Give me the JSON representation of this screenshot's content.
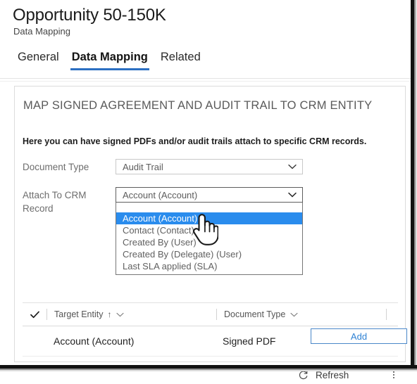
{
  "header": {
    "title": "Opportunity 50-150K",
    "subtitle": "Data Mapping",
    "tabs": [
      {
        "label": "General",
        "active": false
      },
      {
        "label": "Data Mapping",
        "active": true
      },
      {
        "label": "Related",
        "active": false
      }
    ]
  },
  "panel": {
    "section_heading": "MAP SIGNED AGREEMENT AND AUDIT TRAIL TO CRM ENTITY",
    "lead_text": "Here you can have signed PDFs and/or audit trails attach to specific CRM records.",
    "fields": {
      "document_type": {
        "label": "Document Type",
        "value": "Audit Trail",
        "chevron_icon": "chevron-down-icon"
      },
      "attach_to_crm_record": {
        "label": "Attach To CRM Record",
        "value": "Account (Account)",
        "chevron_icon": "chevron-down-icon",
        "expanded": true,
        "options": [
          "Account (Account)",
          "Contact (Contact)",
          "Created By (User)",
          "Created By (Delegate) (User)",
          "Last SLA applied (SLA)"
        ],
        "selected_option": "Account (Account)"
      }
    },
    "add_button": "Add"
  },
  "command_bar": {
    "refresh_icon": "refresh-icon",
    "refresh_label": "Refresh",
    "overflow_icon": "overflow-dots-icon"
  },
  "grid": {
    "select_all_icon": "checkmark-icon",
    "columns": [
      {
        "label": "Target Entity",
        "sort": "↑",
        "chevron_icon": "chevron-down-icon"
      },
      {
        "label": "Document Type",
        "sort": "",
        "chevron_icon": "chevron-down-icon"
      }
    ],
    "rows": [
      {
        "target_entity": "Account (Account)",
        "document_type": "Signed PDF"
      }
    ]
  },
  "cursor": {
    "icon": "hand-pointer-cursor"
  },
  "colors": {
    "tab_underline": "#2b6fc2",
    "dropdown_highlight": "#2a8ced",
    "add_button_text": "#2f82d4",
    "add_button_border": "#4a87c9"
  }
}
